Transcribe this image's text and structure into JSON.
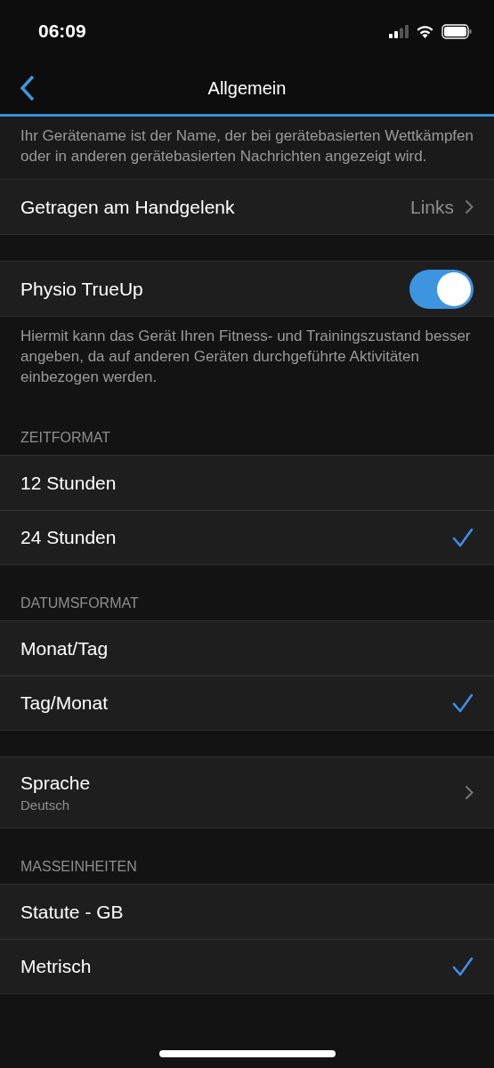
{
  "status_bar": {
    "time": "06:09"
  },
  "nav": {
    "title": "Allgemein"
  },
  "sections": [
    {
      "footer": "Ihr Gerätename ist der Name, der bei gerätebasierten Wettkämpfen oder in anderen gerätebasierten Nachrichten angezeigt wird."
    },
    {
      "rows": [
        {
          "kind": "nav",
          "label": "Getragen am Handgelenk",
          "value": "Links"
        }
      ]
    },
    {
      "rows": [
        {
          "kind": "toggle",
          "label": "Physio TrueUp",
          "on": true
        }
      ],
      "footer": "Hiermit kann das Gerät Ihren Fitness- und Trainingszustand besser angeben, da auf anderen Geräten durchgeführte Aktivitäten einbezogen werden."
    },
    {
      "header": "ZEITFORMAT",
      "rows": [
        {
          "kind": "option",
          "label": "12 Stunden",
          "selected": false
        },
        {
          "kind": "option",
          "label": "24 Stunden",
          "selected": true
        }
      ]
    },
    {
      "header": "DATUMSFORMAT",
      "rows": [
        {
          "kind": "option",
          "label": "Monat/Tag",
          "selected": false
        },
        {
          "kind": "option",
          "label": "Tag/Monat",
          "selected": true
        }
      ]
    },
    {
      "rows": [
        {
          "kind": "nav",
          "label": "Sprache",
          "subtitle": "Deutsch"
        }
      ]
    },
    {
      "header": "MASSEINHEITEN",
      "rows": [
        {
          "kind": "option",
          "label": "Statute - GB",
          "selected": false
        },
        {
          "kind": "option",
          "label": "Metrisch",
          "selected": true
        }
      ]
    }
  ]
}
